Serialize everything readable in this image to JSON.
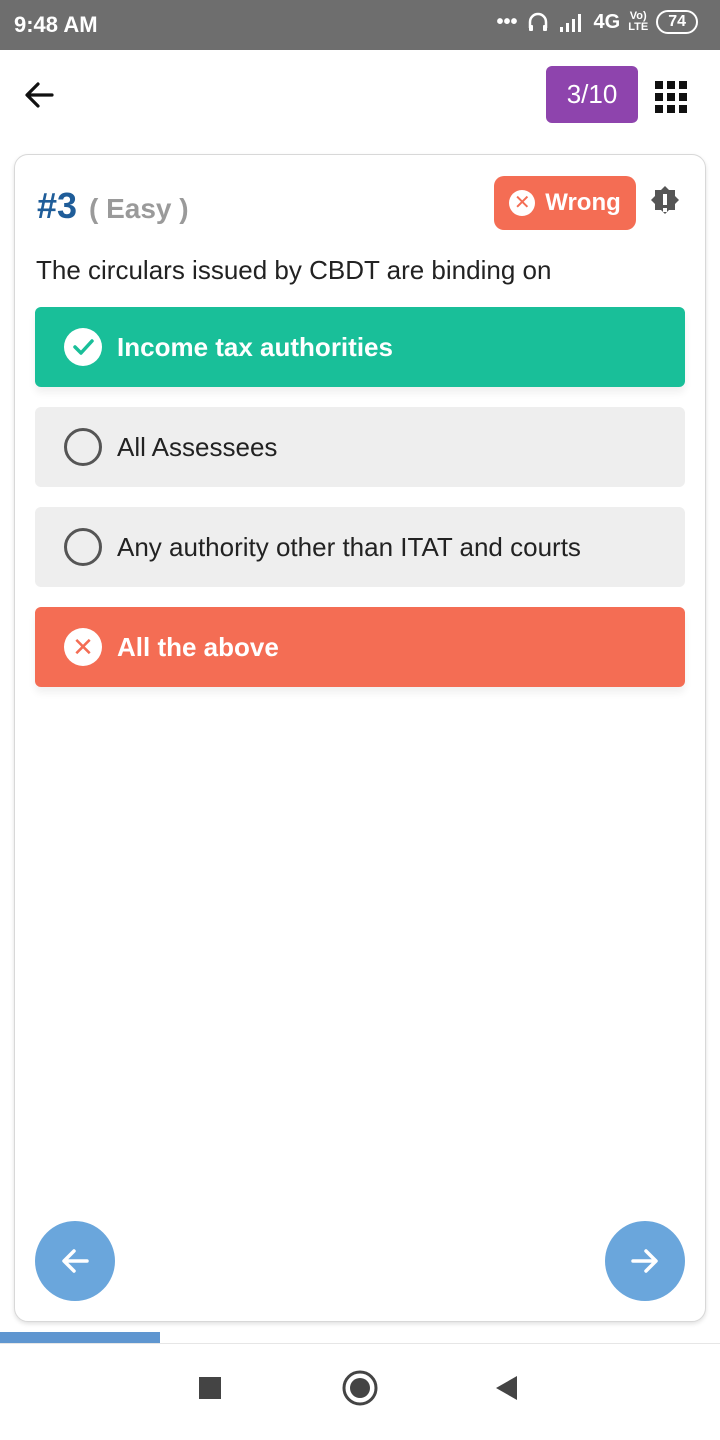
{
  "status_bar": {
    "time": "9:48 AM",
    "network": "4G",
    "lte": "LTE",
    "volte": "Vo)",
    "battery": "74",
    "icons": [
      "more-dots-icon",
      "headphones-icon",
      "signal-icon"
    ]
  },
  "header": {
    "counter": "3/10",
    "back_icon": "arrow-left-icon",
    "grid_icon": "grid-menu-icon"
  },
  "question": {
    "number": "#3",
    "difficulty": "( Easy )",
    "status_label": "Wrong",
    "status_icon": "x-circle-icon",
    "report_icon": "alert-badge-icon",
    "text": "The circulars issued by CBDT are binding on"
  },
  "options": [
    {
      "label": "Income tax authorities",
      "state": "correct"
    },
    {
      "label": "All Assessees",
      "state": "unselected"
    },
    {
      "label": "Any authority other than ITAT and courts",
      "state": "unselected"
    },
    {
      "label": "All the above",
      "state": "wrong"
    }
  ],
  "progress": {
    "fraction": 0.222
  },
  "colors": {
    "correct": "#19bf99",
    "wrong": "#f46d54",
    "counter": "#8e44ad",
    "nav_button": "#6aa6dc",
    "question_number": "#1f5d99"
  }
}
